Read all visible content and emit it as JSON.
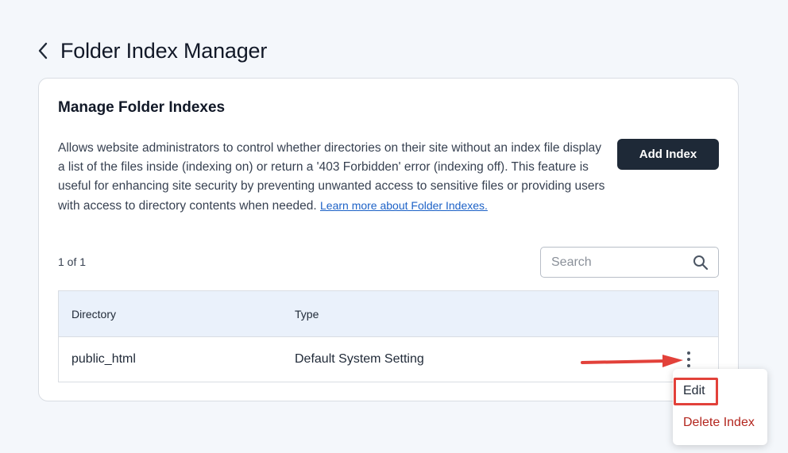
{
  "header": {
    "title": "Folder Index Manager"
  },
  "card": {
    "title": "Manage Folder Indexes",
    "description": "Allows website administrators to control whether directories on their site without an index file display a list of the files inside (indexing on) or return a '403 Forbidden' error (indexing off). This feature is useful for enhancing site security by preventing unwanted access to sensitive files or providing users with access to directory contents when needed.",
    "learn_more_link": "Learn more about Folder Indexes.",
    "add_button": "Add Index",
    "page_count": "1 of 1",
    "search_placeholder": "Search"
  },
  "table": {
    "columns": [
      "Directory",
      "Type"
    ],
    "rows": [
      {
        "directory": "public_html",
        "type": "Default System Setting"
      }
    ]
  },
  "context_menu": {
    "items": [
      "Edit",
      "Delete Index"
    ]
  },
  "colors": {
    "primary_button": "#1e2937",
    "link": "#1d62c7",
    "danger": "#b3261e",
    "annotation": "#e2413a",
    "table_header_bg": "#eaf1fb"
  }
}
